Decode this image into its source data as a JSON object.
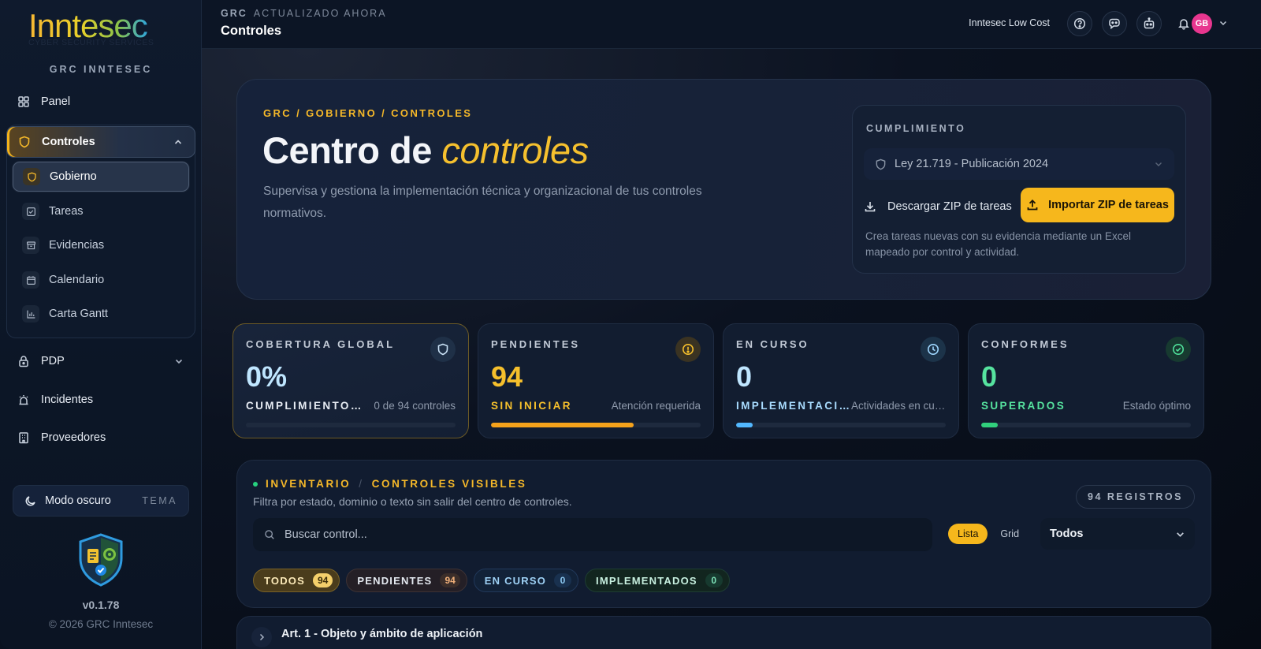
{
  "brand": {
    "logo_text": "Inntesec",
    "logo_tagline": "CYBER SECURITY SERVICES",
    "app_name": "GRC INNTESEC"
  },
  "sidebar": {
    "items": [
      {
        "label": "Panel",
        "icon": "grid-icon"
      },
      {
        "label": "Controles",
        "icon": "shield-icon",
        "active": true
      },
      {
        "label": "PDP",
        "icon": "lock-icon"
      },
      {
        "label": "Incidentes",
        "icon": "alarm-icon"
      },
      {
        "label": "Proveedores",
        "icon": "building-icon"
      }
    ],
    "sub_items": [
      {
        "label": "Gobierno",
        "icon": "shield-icon",
        "active": true
      },
      {
        "label": "Tareas",
        "icon": "checkbox-icon"
      },
      {
        "label": "Evidencias",
        "icon": "archive-icon"
      },
      {
        "label": "Calendario",
        "icon": "calendar-icon"
      },
      {
        "label": "Carta Gantt",
        "icon": "bar-chart-icon"
      }
    ],
    "theme_label": "Modo oscuro",
    "theme_tag": "TEMA",
    "version": "v0.1.78",
    "copyright": "© 2026 GRC Inntesec"
  },
  "topbar": {
    "section": "GRC",
    "status": "ACTUALIZADO AHORA",
    "title": "Controles",
    "tenant": "Inntesec Low Cost",
    "avatar_initials": "GB"
  },
  "hero": {
    "breadcrumb": "GRC / GOBIERNO / CONTROLES",
    "title_main": "Centro de ",
    "title_accent": "controles",
    "description": "Supervisa y gestiona la implementación técnica y organizacional de tus controles normativos.",
    "compliance": {
      "label": "CUMPLIMIENTO",
      "selected": "Ley 21.719 - Publicación 2024",
      "download_label": "Descargar ZIP de tareas",
      "import_label": "Importar ZIP de tareas",
      "note": "Crea tareas nuevas con su evidencia mediante un Excel mapeado por control y actividad."
    }
  },
  "stats": [
    {
      "label": "COBERTURA GLOBAL",
      "value": "0%",
      "sub": "CUMPLIMIENTO NORMATIVO",
      "hint": "0 de 94 controles",
      "progress": 0,
      "icon": "shield-icon",
      "value_color": "#bfe6ff",
      "sub_color": "#e7ecf3",
      "bar_color": "#38b6ff"
    },
    {
      "label": "PENDIENTES",
      "value": "94",
      "sub": "SIN INICIAR",
      "hint": "Atención requerida",
      "progress": 0.68,
      "icon": "alert-circle-icon",
      "value_color": "#f6c02c",
      "sub_color": "#f6c02c",
      "bar_color": "#f5a21b"
    },
    {
      "label": "EN CURSO",
      "value": "0",
      "sub": "IMPLEMENTACIÓN",
      "hint": "Actividades en curso",
      "progress": 0.08,
      "icon": "clock-icon",
      "value_color": "#bfe6ff",
      "sub_color": "#a9dcff",
      "bar_color": "#52b8ff"
    },
    {
      "label": "CONFORMES",
      "value": "0",
      "sub": "SUPERADOS",
      "hint": "Estado óptimo",
      "progress": 0.08,
      "icon": "check-circle-icon",
      "value_color": "#56e39f",
      "sub_color": "#56e39f",
      "bar_color": "#31d07d"
    }
  ],
  "inventory": {
    "title_a": "INVENTARIO",
    "title_b": "CONTROLES VISIBLES",
    "description": "Filtra por estado, dominio o texto sin salir del centro de controles.",
    "count": "94 REGISTROS",
    "search_placeholder": "Buscar control...",
    "view_list": "Lista",
    "view_grid": "Grid",
    "filter_value": "Todos",
    "chips": [
      {
        "label": "TODOS",
        "count": "94"
      },
      {
        "label": "PENDIENTES",
        "count": "94"
      },
      {
        "label": "EN CURSO",
        "count": "0"
      },
      {
        "label": "IMPLEMENTADOS",
        "count": "0"
      }
    ]
  },
  "articles": [
    {
      "title": "Art. 1 - Objeto y ámbito de aplicación"
    }
  ]
}
